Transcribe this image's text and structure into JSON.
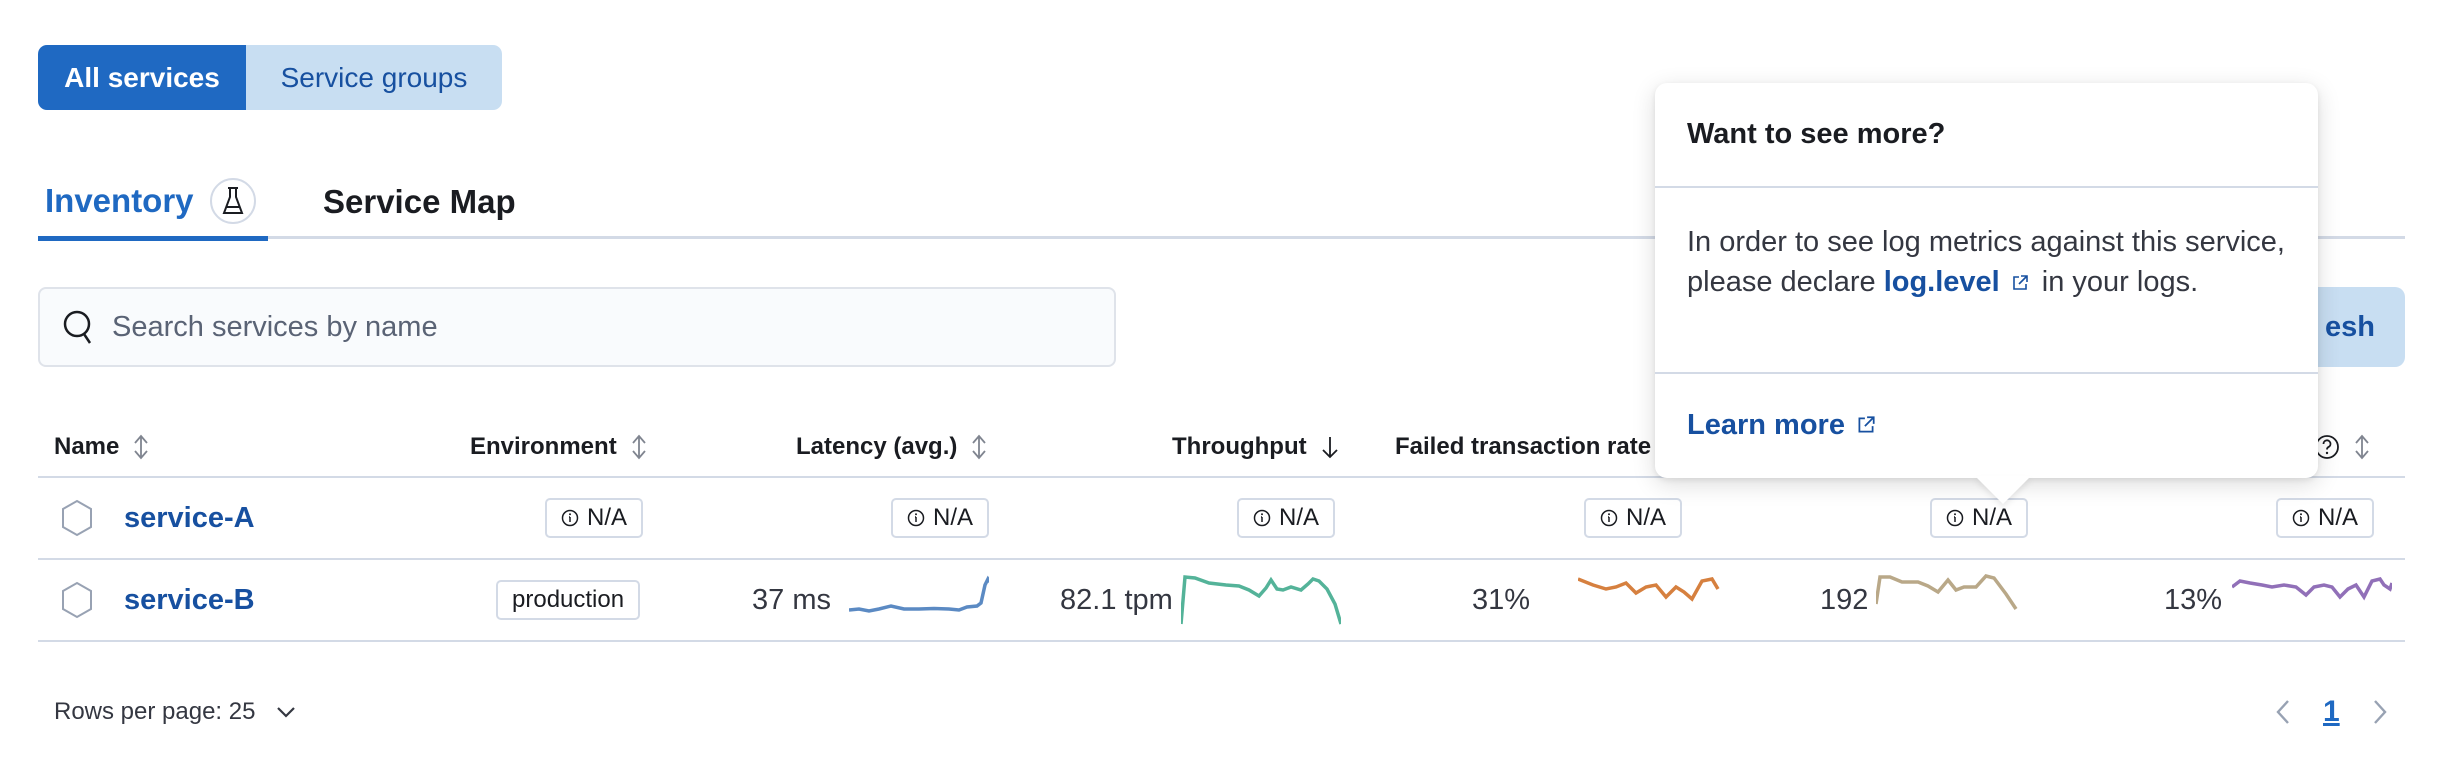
{
  "view_toggle": {
    "all_services": "All services",
    "service_groups": "Service groups"
  },
  "tabs": [
    {
      "label": "Inventory",
      "badge_icon": "beaker-icon",
      "selected": true
    },
    {
      "label": "Service Map",
      "selected": false
    }
  ],
  "search": {
    "placeholder": "Search services by name",
    "value": ""
  },
  "refresh_button": {
    "label": "Refresh",
    "visible_fragment": "esh"
  },
  "table": {
    "columns": [
      {
        "label": "Name",
        "sort": "sortable"
      },
      {
        "label": "Environment",
        "sort": "sortable"
      },
      {
        "label": "Latency (avg.)",
        "sort": "sortable"
      },
      {
        "label": "Throughput",
        "sort": "descending"
      },
      {
        "label": "Failed transaction rate",
        "sort": "sortable"
      },
      {
        "label": "",
        "sort": "hidden"
      },
      {
        "label": "",
        "sort": "sortable",
        "help_icon": true
      }
    ],
    "rows": [
      {
        "name": "service-A",
        "environment": "N/A",
        "latency": "N/A",
        "throughput": "N/A",
        "failed_rate": "N/A",
        "col6": "N/A",
        "col7": "N/A"
      },
      {
        "name": "service-B",
        "environment": "production",
        "latency": "37 ms",
        "throughput": "82.1 tpm",
        "failed_rate": "31%",
        "col6": "192",
        "col7": "13%"
      }
    ],
    "sparkline_colors": {
      "latency": "#5b8ac3",
      "throughput": "#54b399",
      "failed_rate": "#d6803f",
      "col6": "#b9a888",
      "col7": "#9170b8"
    }
  },
  "pagination": {
    "rows_per_page_label": "Rows per page: 25",
    "current_page": "1"
  },
  "popover": {
    "title": "Want to see more?",
    "body_before": "In order to see log metrics against this service, please declare ",
    "body_link": "log.level",
    "body_after": " in your logs.",
    "learn_more": "Learn more"
  },
  "colors": {
    "primary": "#1f69c2",
    "primary_light": "#c8def2",
    "link": "#1750a0",
    "border": "#d3dae6"
  }
}
